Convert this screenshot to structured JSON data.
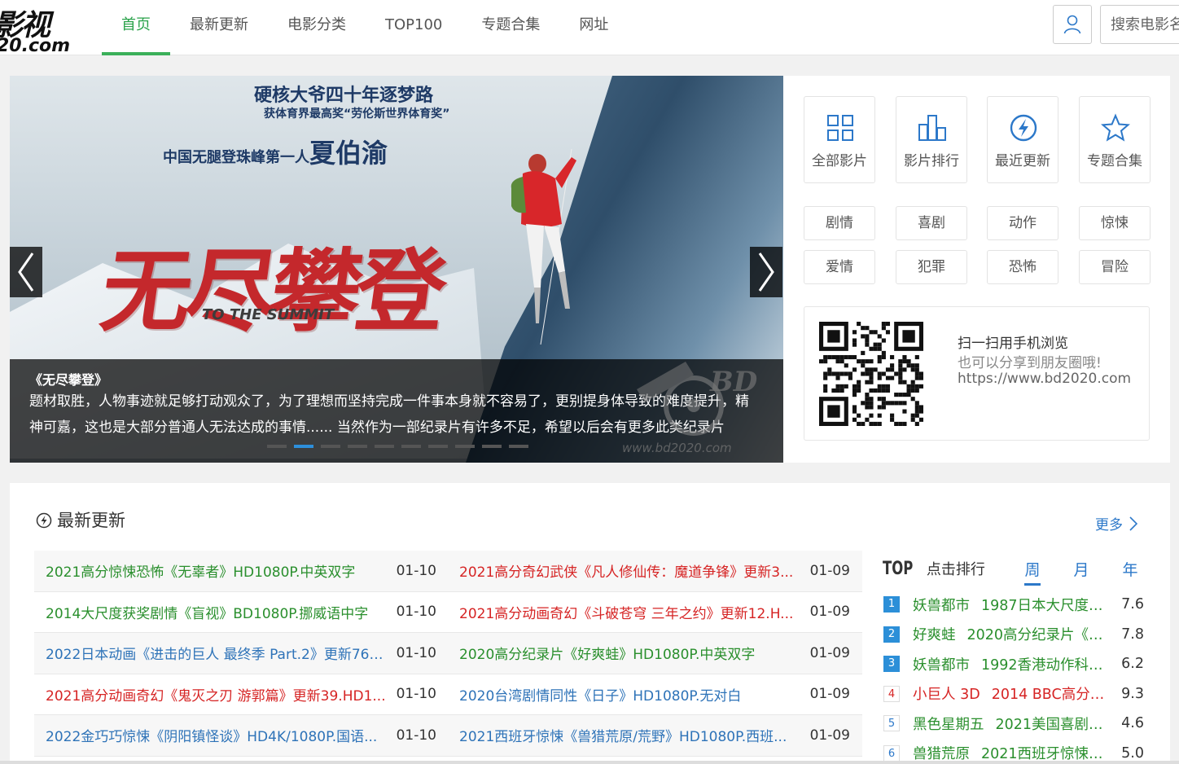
{
  "logo": {
    "line1": "影视",
    "line2": "20.com"
  },
  "nav": {
    "items": [
      "首页",
      "最新更新",
      "电影分类",
      "TOP100",
      "专题合集",
      "网址"
    ],
    "active": 0
  },
  "search": {
    "placeholder": "搜索电影名"
  },
  "banner": {
    "headline1": "硬核大爷四十年逐梦路",
    "headline2": "获体育界最高奖“劳伦斯世界体育奖”",
    "headline3_prefix": "中国无腿登珠峰第一人",
    "headline3_name": "夏伯渝",
    "poster_title": "无尽攀登",
    "poster_subtitle": "TO THE SUMMIT",
    "caption_title": "《无尽攀登》",
    "caption_text": "题材取胜，人物事迹就足够打动观众了，为了理想而坚持完成一件事本身就不容易了，更别提身体导致的难度提升，精神可嘉，这也是大部分普通人无法达成的事情...... 当然作为一部纪录片有许多不足，希望以后会有更多此类纪录片",
    "watermark_text": "BD",
    "watermark_url": "www.bd2020.com",
    "slide_count": 10,
    "active_slide": 1
  },
  "quick_links": [
    {
      "label": "全部影片",
      "icon": "grid-icon"
    },
    {
      "label": "影片排行",
      "icon": "bar-chart-icon"
    },
    {
      "label": "最近更新",
      "icon": "lightning-icon"
    },
    {
      "label": "专题合集",
      "icon": "star-icon"
    }
  ],
  "categories": [
    "剧情",
    "喜剧",
    "动作",
    "惊悚",
    "爱情",
    "犯罪",
    "恐怖",
    "冒险"
  ],
  "qr": {
    "line1": "扫一扫用手机浏览",
    "line2": "也可以分享到朋友圈哦!",
    "line3": "https://www.bd2020.com"
  },
  "latest": {
    "title": "最新更新",
    "more": "更多",
    "rows": [
      [
        {
          "title": "2021高分惊悚恐怖《无辜者》HD1080P.中英双字",
          "date": "01-10",
          "color": "green"
        },
        {
          "title": "2021高分奇幻武侠《凡人修仙传：魔道争锋》更新3...",
          "date": "01-09",
          "color": "red"
        }
      ],
      [
        {
          "title": "2014大尺度获奖剧情《盲视》BD1080P.挪威语中字",
          "date": "01-10",
          "color": "green"
        },
        {
          "title": "2021高分动画奇幻《斗破苍穹 三年之约》更新12.H...",
          "date": "01-09",
          "color": "red"
        }
      ],
      [
        {
          "title": "2022日本动画《进击的巨人 最终季 Part.2》更新76....",
          "date": "01-10",
          "color": "blue"
        },
        {
          "title": "2020高分纪录片《好爽蛙》HD1080P.中英双字",
          "date": "01-09",
          "color": "green"
        }
      ],
      [
        {
          "title": "2021高分动画奇幻《鬼灭之刃 游郭篇》更新39.HD1...",
          "date": "01-10",
          "color": "red"
        },
        {
          "title": "2020台湾剧情同性《日子》HD1080P.无对白",
          "date": "01-09",
          "color": "blue"
        }
      ],
      [
        {
          "title": "2022金巧巧惊悚《阴阳镇怪谈》HD4K/1080P.国语...",
          "date": "01-10",
          "color": "blue"
        },
        {
          "title": "2021西班牙惊悚《兽猎荒原/荒野》HD1080P.西班...",
          "date": "01-09",
          "color": "blue"
        }
      ]
    ]
  },
  "ranking": {
    "title_top": "TOP",
    "title_rest": "点击排行",
    "tabs": [
      "周",
      "月",
      "年"
    ],
    "active_tab": 0,
    "items": [
      {
        "no": "1",
        "name": "妖兽都市",
        "desc": "1987日本大尺度动...",
        "score": "7.6",
        "color": "green"
      },
      {
        "no": "2",
        "name": "好爽蛙",
        "desc": "2020高分纪录片《好...",
        "score": "7.8",
        "color": "green"
      },
      {
        "no": "3",
        "name": "妖兽都市",
        "desc": "1992香港动作科幻...",
        "score": "6.2",
        "color": "green"
      },
      {
        "no": "4",
        "name": "小巨人 3D",
        "desc": "2014 BBC高分纪...",
        "score": "9.3",
        "color": "red"
      },
      {
        "no": "5",
        "name": "黑色星期五",
        "desc": "2021美国喜剧恐...",
        "score": "4.6",
        "color": "green"
      },
      {
        "no": "6",
        "name": "兽猎荒原",
        "desc": "2021西班牙惊悚《...",
        "score": "5.0",
        "color": "green"
      }
    ]
  }
}
